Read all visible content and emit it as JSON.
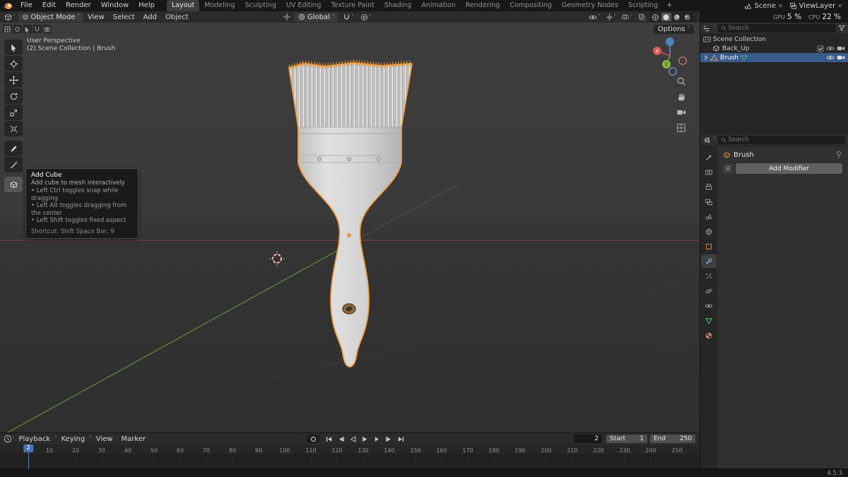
{
  "icons": {
    "caret_down": "˅",
    "close": "✕"
  },
  "topbar": {
    "menus": [
      "File",
      "Edit",
      "Render",
      "Window",
      "Help"
    ],
    "tabs": [
      "Layout",
      "Modeling",
      "Sculpting",
      "UV Editing",
      "Texture Paint",
      "Shading",
      "Animation",
      "Rendering",
      "Compositing",
      "Geometry Nodes",
      "Scripting"
    ],
    "active_tab": "Layout",
    "add_tab_label": "+",
    "scene_name": "Scene",
    "view_layer_name": "ViewLayer",
    "gpu_label": "GPU",
    "gpu_value": "5 %",
    "cpu_label": "CPU",
    "cpu_value": "22 %"
  },
  "tool_header": {
    "mode": "Object Mode",
    "menus": [
      "View",
      "Select",
      "Add",
      "Object"
    ],
    "orientation": "Global",
    "options_label": "Options"
  },
  "viewport": {
    "perspective_label": "User Perspective",
    "collection_label": "(2) Scene Collection | Brush"
  },
  "tooltip": {
    "title": "Add Cube",
    "description": "Add cube to mesh interactively",
    "bullets": [
      "Left Ctrl toggles snap while dragging",
      "Left Alt toggles dragging from the center",
      "Left Shift toggles fixed aspect"
    ],
    "shortcut": "Shortcut: Shift Space Bar, 9"
  },
  "outliner": {
    "search_placeholder": "Search",
    "scene_collection_label": "Scene Collection",
    "items": [
      {
        "label": "Back_Up"
      },
      {
        "label": "Brush"
      }
    ]
  },
  "properties": {
    "search_placeholder": "Search",
    "object_name": "Brush",
    "add_modifier_label": "Add Modifier"
  },
  "timeline": {
    "menus": [
      "Playback",
      "Keying",
      "View",
      "Marker"
    ],
    "current_frame": 2,
    "start_label": "Start",
    "start_value": "1",
    "end_label": "End",
    "end_value": "250",
    "ticks": [
      10,
      20,
      30,
      40,
      50,
      60,
      70,
      80,
      90,
      100,
      110,
      120,
      130,
      140,
      150,
      160,
      170,
      180,
      190,
      200,
      210,
      220,
      230,
      240,
      250
    ]
  },
  "status_bar": {
    "version": "4.5.3"
  },
  "colors": {
    "accent": "#4772b3",
    "selection": "#f59e42"
  }
}
